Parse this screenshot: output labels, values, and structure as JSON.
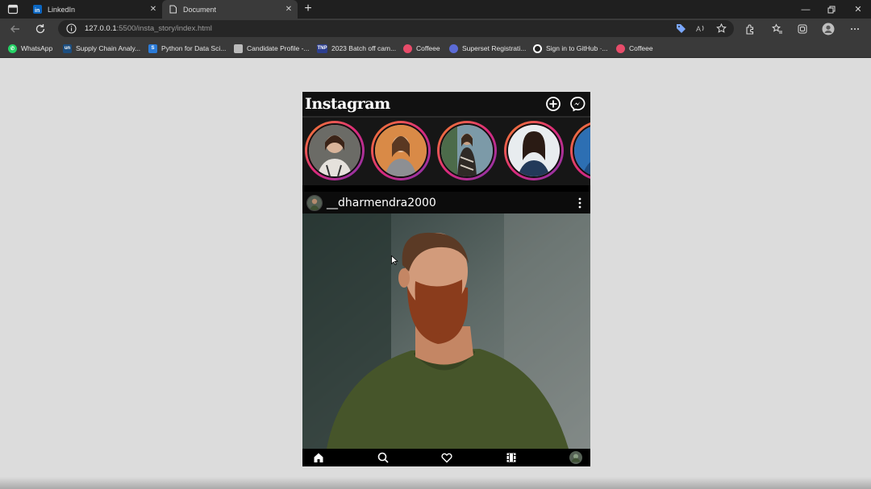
{
  "browser": {
    "tabs": [
      {
        "title": "LinkedIn",
        "icon": "linkedin-icon",
        "active": false
      },
      {
        "title": "Document",
        "icon": "document-icon",
        "active": true
      }
    ],
    "url_host": "127.0.0.1",
    "url_path": ":5500/insta_story/index.html",
    "bookmarks": [
      {
        "label": "WhatsApp",
        "icon": "whatsapp-icon",
        "color": "#25d366"
      },
      {
        "label": "Supply Chain Analy...",
        "icon": "unstop-icon",
        "color": "#1c4e80"
      },
      {
        "label": "Python for Data Sci...",
        "icon": "skillup-icon",
        "color": "#2b7bd8"
      },
      {
        "label": "Candidate Profile -...",
        "icon": "document-icon",
        "color": "#bbbbbb"
      },
      {
        "label": "2023 Batch off cam...",
        "icon": "tnp-icon",
        "color": "#2d3f8f"
      },
      {
        "label": "Coffeee",
        "icon": "coffee-icon",
        "color": "#e84c6a"
      },
      {
        "label": "Superset Registrati...",
        "icon": "superset-icon",
        "color": "#5b6bd6"
      },
      {
        "label": "Sign in to GitHub ·...",
        "icon": "github-icon",
        "color": "#ffffff"
      },
      {
        "label": "Coffeee",
        "icon": "coffee-icon",
        "color": "#e84c6a"
      }
    ]
  },
  "app": {
    "logo": "Instagram",
    "post_username": "__dharmendra2000",
    "story_count": 5,
    "accent": "#dd2a7b"
  }
}
